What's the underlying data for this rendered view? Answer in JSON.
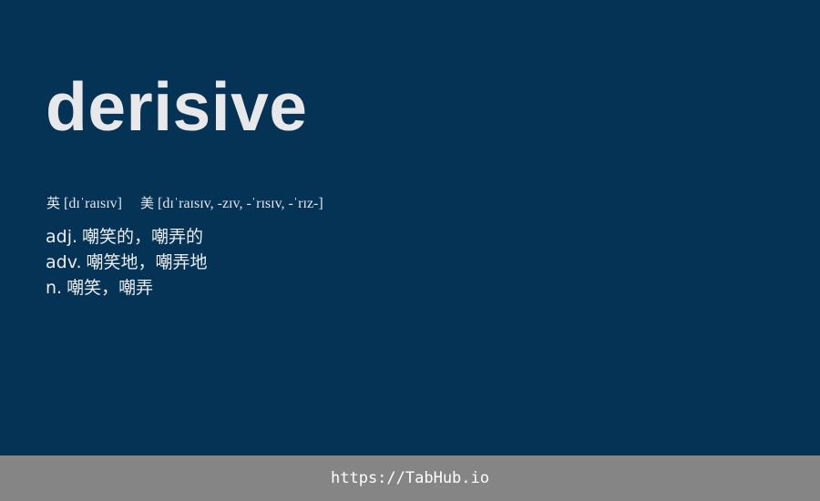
{
  "word": {
    "headword": "derisive",
    "pronunciations": [
      {
        "region": "英",
        "ipa": "[dɪˈraɪsɪv]"
      },
      {
        "region": "美",
        "ipa": "[dɪˈraɪsɪv, -zɪv, -ˈrɪsɪv, -ˈrɪz-]"
      }
    ],
    "definitions": [
      {
        "pos": "adj.",
        "meaning": "嘲笑的，嘲弄的"
      },
      {
        "pos": "adv.",
        "meaning": "嘲笑地，嘲弄地"
      },
      {
        "pos": "n.",
        "meaning": "嘲笑，嘲弄"
      }
    ]
  },
  "footer": {
    "link_text": "https://TabHub.io"
  },
  "colors": {
    "background": "#043355",
    "footer_background": "#858585",
    "text": "#e8e8ea"
  }
}
